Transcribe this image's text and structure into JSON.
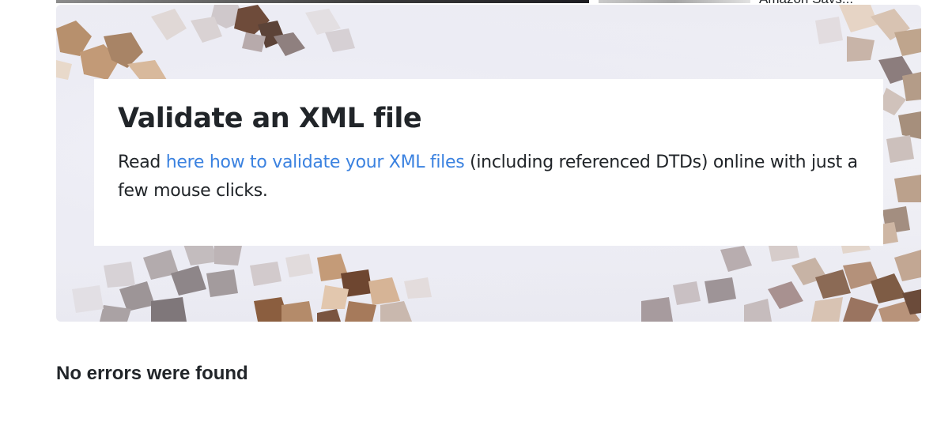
{
  "top_strip": {
    "cut_text": "Amazon Savs..."
  },
  "hero": {
    "title": "Validate an XML file",
    "text_before_link": "Read ",
    "link_text": "here how to validate your XML files",
    "text_after_link": " (including referenced DTDs) online with just a few mouse clicks."
  },
  "result": {
    "message": "No errors were found"
  }
}
